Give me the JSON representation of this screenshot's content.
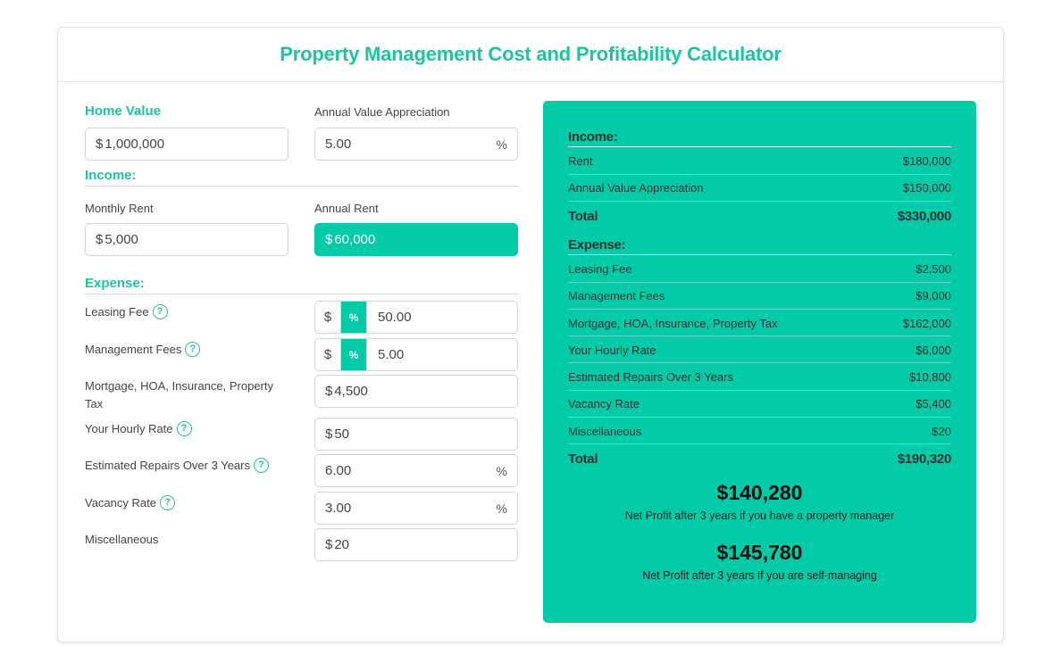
{
  "title": "Property Management Cost and Profitability Calculator",
  "form": {
    "home_value_label": "Home Value",
    "home_value_prefix": "$",
    "home_value": "1,000,000",
    "appreciation_label": "Annual Value Appreciation",
    "appreciation_value": "5.00",
    "appreciation_suffix": "%",
    "income_heading": "Income:",
    "monthly_rent_label": "Monthly Rent",
    "monthly_rent_prefix": "$",
    "monthly_rent": "5,000",
    "annual_rent_label": "Annual Rent",
    "annual_rent_prefix": "$",
    "annual_rent": "60,000",
    "expense_heading": "Expense:",
    "leasing_fee_label": "Leasing Fee",
    "leasing_fee_dollar": "$",
    "leasing_fee_percent": "%",
    "leasing_fee_value": "50.00",
    "management_fees_label": "Management Fees",
    "management_fees_dollar": "$",
    "management_fees_percent": "%",
    "management_fees_value": "5.00",
    "mortgage_label_line1": "Mortgage, HOA, Insurance, Property",
    "mortgage_label_line2": "Tax",
    "mortgage_prefix": "$",
    "mortgage_value": "4,500",
    "hourly_rate_label": "Your Hourly Rate",
    "hourly_rate_prefix": "$",
    "hourly_rate_value": "50",
    "repairs_label": "Estimated Repairs Over 3 Years",
    "repairs_value": "6.00",
    "repairs_suffix": "%",
    "vacancy_label": "Vacancy Rate",
    "vacancy_value": "3.00",
    "vacancy_suffix": "%",
    "misc_label": "Miscellaneous",
    "misc_prefix": "$",
    "misc_value": "20",
    "help_glyph": "?"
  },
  "summary": {
    "income_heading": "Income:",
    "income_rows": [
      {
        "label": "Rent",
        "value": "$180,000"
      },
      {
        "label": "Annual Value Appreciation",
        "value": "$150,000"
      }
    ],
    "income_total_label": "Total",
    "income_total_value": "$330,000",
    "expense_heading": "Expense:",
    "expense_rows": [
      {
        "label": "Leasing Fee",
        "value": "$2,500"
      },
      {
        "label": "Management Fees",
        "value": "$9,000"
      },
      {
        "label": "Mortgage, HOA, Insurance, Property Tax",
        "value": "$162,000"
      },
      {
        "label": "Your Hourly Rate",
        "value": "$6,000"
      },
      {
        "label": "Estimated Repairs Over 3 Years",
        "value": "$10,800"
      },
      {
        "label": "Vacancy Rate",
        "value": "$5,400"
      },
      {
        "label": "Miscellaneous",
        "value": "$20"
      }
    ],
    "expense_total_label": "Total",
    "expense_total_value": "$190,320",
    "profit_manager_value": "$140,280",
    "profit_manager_caption": "Net Profit after 3 years if you have a property manager",
    "profit_self_value": "$145,780",
    "profit_self_caption": "Net Profit after 3 years If you are self-managing"
  },
  "colors": {
    "accent": "#1ec59c",
    "panel": "#03cba7"
  }
}
